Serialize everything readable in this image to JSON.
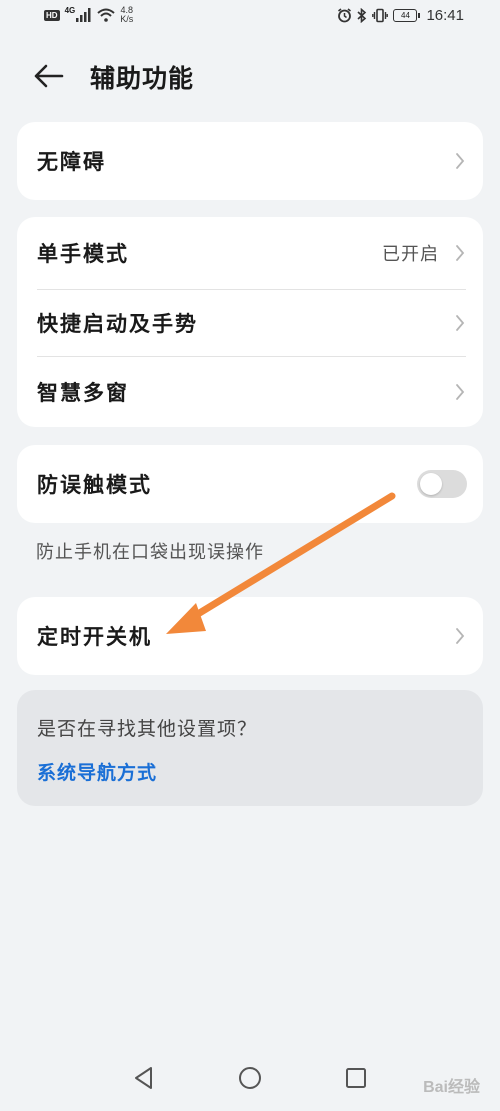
{
  "status_bar": {
    "network_badge": "HD",
    "network_type": "4G",
    "speed_value": "4.8",
    "speed_unit": "K/s",
    "battery": "44",
    "time": "16:41"
  },
  "header": {
    "title": "辅助功能"
  },
  "cards": {
    "accessibility": {
      "label": "无障碍"
    },
    "group": {
      "one_hand": {
        "label": "单手模式",
        "value": "已开启"
      },
      "shortcuts": {
        "label": "快捷启动及手势"
      },
      "multi_window": {
        "label": "智慧多窗"
      }
    },
    "pocket_mode": {
      "label": "防误触模式",
      "enabled": false,
      "note": "防止手机在口袋出现误操作"
    },
    "scheduled_power": {
      "label": "定时开关机"
    }
  },
  "suggestion": {
    "question": "是否在寻找其他设置项？",
    "link": "系统导航方式"
  },
  "colors": {
    "background": "#f1f3f5",
    "card": "#ffffff",
    "link": "#1a6fd6",
    "annotation_arrow": "#f2883a"
  },
  "watermark": "Bai经验"
}
